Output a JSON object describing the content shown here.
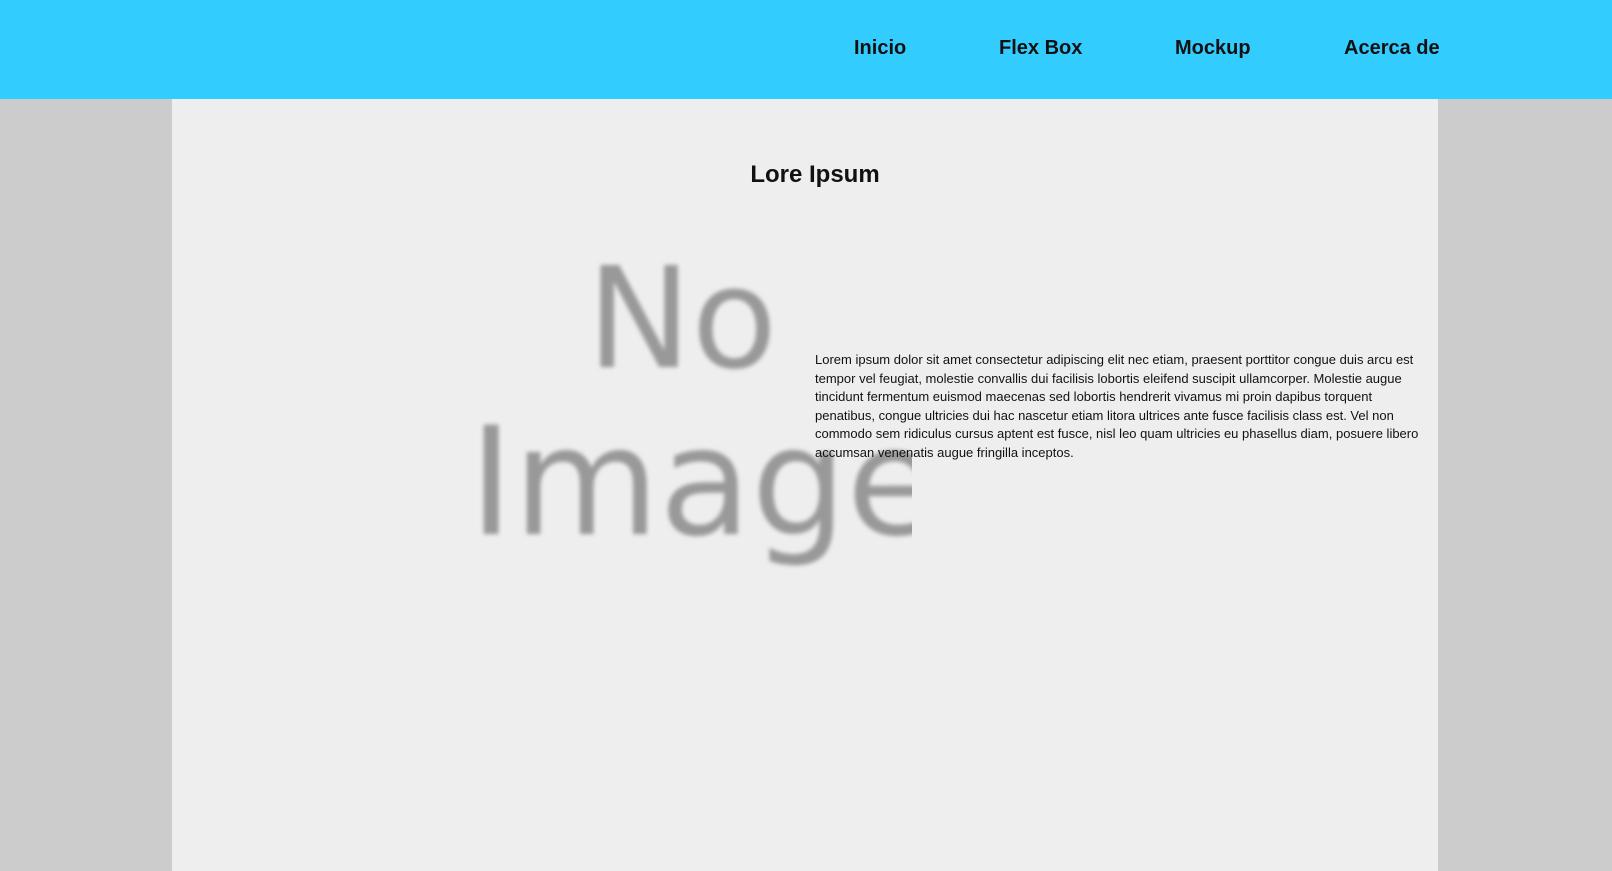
{
  "nav": {
    "items": [
      {
        "label": "Inicio"
      },
      {
        "label": "Flex Box"
      },
      {
        "label": "Mockup"
      },
      {
        "label": "Acerca de"
      }
    ]
  },
  "main": {
    "title": "Lore Ipsum",
    "image": {
      "line1": "No",
      "line2": "Image"
    },
    "paragraph": "Lorem ipsum dolor sit amet consectetur adipiscing elit nec etiam, praesent porttitor congue duis arcu est tempor vel feugiat, molestie convallis dui facilisis lobortis eleifend suscipit ullamcorper. Molestie augue tincidunt fermentum euismod maecenas sed lobortis hendrerit vivamus mi proin dapibus torquent penatibus, congue ultricies dui hac nascetur etiam litora ultrices ante fusce facilisis class est. Vel non commodo sem ridiculus cursus aptent est fusce, nisl leo quam ultricies eu phasellus diam, posuere libero accumsan venenatis augue fringilla inceptos."
  },
  "colors": {
    "header_bg": "#33ccff",
    "page_bg": "#cccccc",
    "content_bg": "#eeeeee",
    "placeholder_text": "#999999"
  }
}
